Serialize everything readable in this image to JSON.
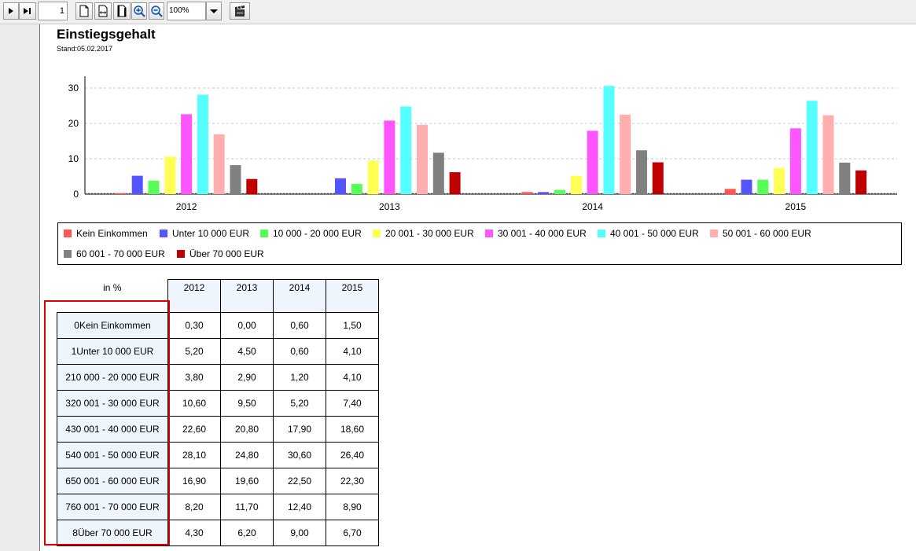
{
  "toolbar": {
    "page_number": "1",
    "zoom": "100%",
    "buttons": [
      "play-icon",
      "skip-to-end-icon",
      "page-icon",
      "page-width-icon",
      "page-height-icon",
      "zoom-in-icon",
      "zoom-out-icon",
      "clapperboard-icon"
    ]
  },
  "report": {
    "title": "Einstiegsgehalt",
    "subtitle": "Stand:05.02.2017"
  },
  "chart_data": {
    "type": "bar",
    "categories": [
      "2012",
      "2013",
      "2014",
      "2015"
    ],
    "ylim": [
      0,
      32
    ],
    "yticks": [
      "0",
      "10",
      "20",
      "30"
    ],
    "grid": true,
    "legend": "bottom",
    "series": [
      {
        "name": "Kein Einkommen",
        "color": "#ff5555",
        "values": [
          0.3,
          0.0,
          0.6,
          1.5
        ]
      },
      {
        "name": "Unter 10 000 EUR",
        "color": "#5555ff",
        "values": [
          5.2,
          4.5,
          0.6,
          4.1
        ]
      },
      {
        "name": "10 000 - 20 000 EUR",
        "color": "#55ff55",
        "values": [
          3.8,
          2.9,
          1.2,
          4.1
        ]
      },
      {
        "name": "20 001 - 30 000 EUR",
        "color": "#ffff55",
        "values": [
          10.6,
          9.5,
          5.2,
          7.4
        ]
      },
      {
        "name": "30 001 - 40 000 EUR",
        "color": "#ff55ff",
        "values": [
          22.6,
          20.8,
          17.9,
          18.6
        ]
      },
      {
        "name": "40 001 - 50 000 EUR",
        "color": "#55ffff",
        "values": [
          28.1,
          24.8,
          30.6,
          26.4
        ]
      },
      {
        "name": "50 001 - 60 000 EUR",
        "color": "#ffafaf",
        "values": [
          16.9,
          19.6,
          22.5,
          22.3
        ]
      },
      {
        "name": "60 001 - 70 000 EUR",
        "color": "#808080",
        "values": [
          8.2,
          11.7,
          12.4,
          8.9
        ]
      },
      {
        "name": "Über 70 000 EUR",
        "color": "#c00000",
        "values": [
          4.3,
          6.2,
          9.0,
          6.7
        ]
      }
    ]
  },
  "table": {
    "corner_label": "in %",
    "columns": [
      "2012",
      "2013",
      "2014",
      "2015"
    ],
    "rows": [
      {
        "label": "0Kein Einkommen",
        "cells": [
          "0,30",
          "0,00",
          "0,60",
          "1,50"
        ]
      },
      {
        "label": "1Unter 10 000 EUR",
        "cells": [
          "5,20",
          "4,50",
          "0,60",
          "4,10"
        ]
      },
      {
        "label": "210 000 - 20 000 EUR",
        "cells": [
          "3,80",
          "2,90",
          "1,20",
          "4,10"
        ]
      },
      {
        "label": "320 001 - 30 000 EUR",
        "cells": [
          "10,60",
          "9,50",
          "5,20",
          "7,40"
        ]
      },
      {
        "label": "430 001 - 40 000 EUR",
        "cells": [
          "22,60",
          "20,80",
          "17,90",
          "18,60"
        ]
      },
      {
        "label": "540 001 - 50 000 EUR",
        "cells": [
          "28,10",
          "24,80",
          "30,60",
          "26,40"
        ]
      },
      {
        "label": "650 001 - 60 000 EUR",
        "cells": [
          "16,90",
          "19,60",
          "22,50",
          "22,30"
        ]
      },
      {
        "label": "760 001 - 70 000 EUR",
        "cells": [
          "8,20",
          "11,70",
          "12,40",
          "8,90"
        ]
      },
      {
        "label": "8Über 70 000 EUR",
        "cells": [
          "4,30",
          "6,20",
          "9,00",
          "6,70"
        ]
      }
    ]
  },
  "highlight": {
    "color": "#e00000"
  }
}
